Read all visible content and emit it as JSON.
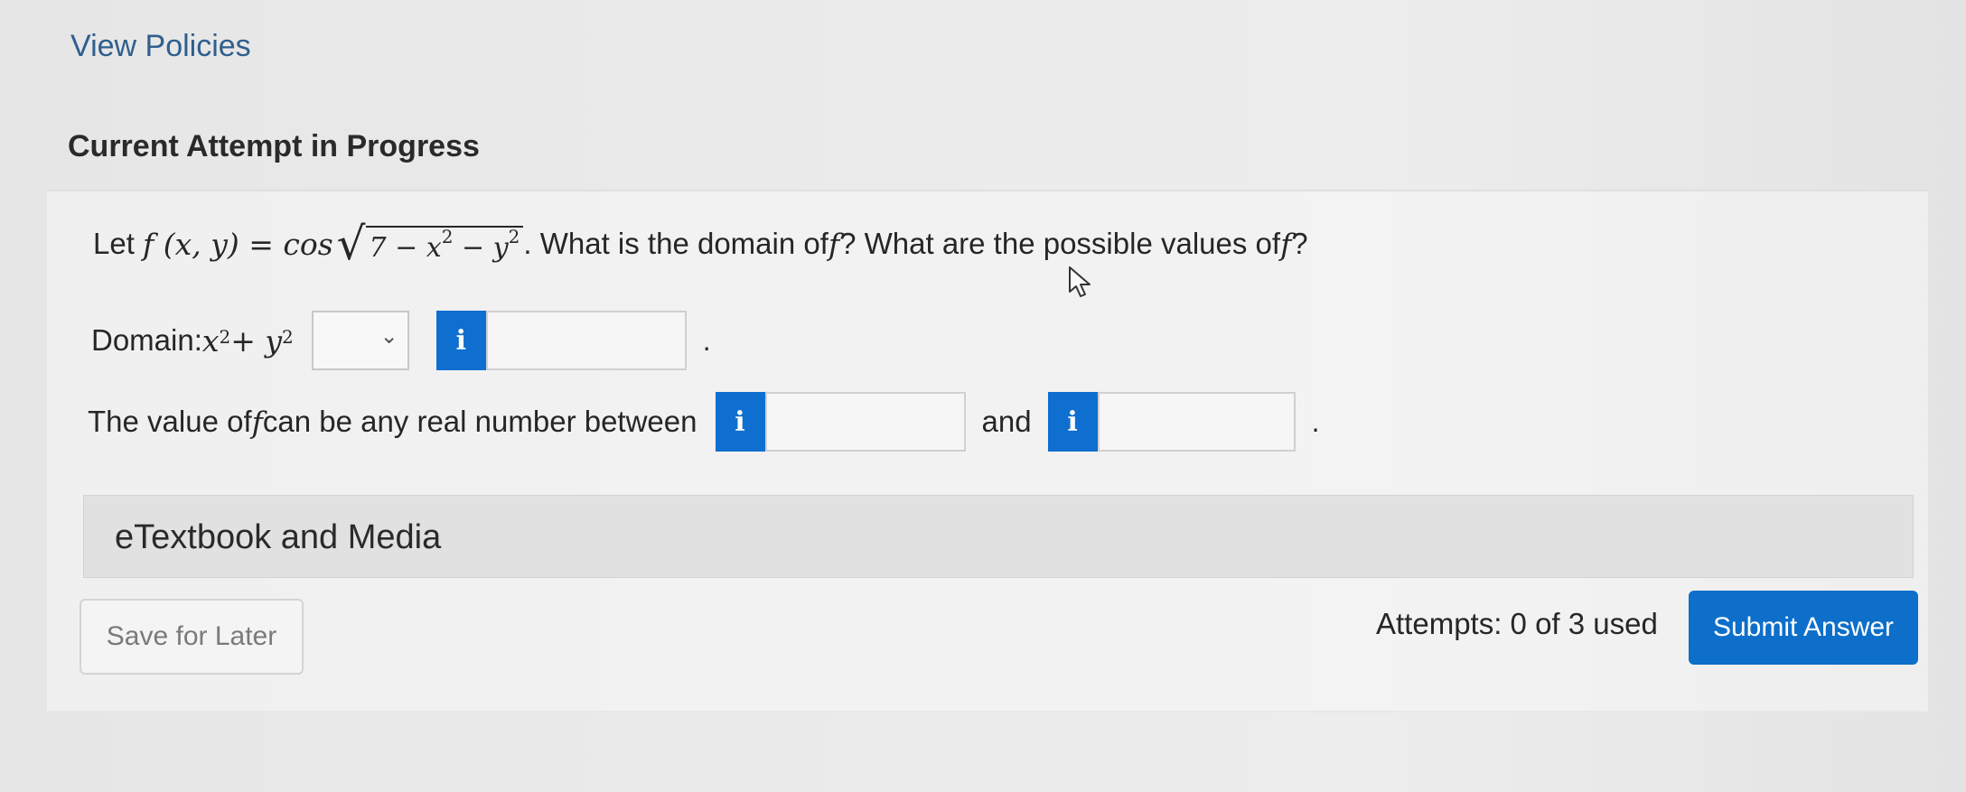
{
  "nav": {
    "view_policies": "View Policies"
  },
  "heading": "Current Attempt in Progress",
  "question": {
    "prefix": "Let ",
    "fn": "f (x, y) = cos",
    "radicand_a": "7 − x",
    "sup1": "2",
    "radicand_b": " − y",
    "sup2": "2",
    "suffix_a": ". What is the domain of ",
    "f1": "f",
    "suffix_b": "? What are the possible values of ",
    "f2": "f",
    "suffix_c": "?"
  },
  "domain": {
    "label": "Domain: ",
    "expr_a": "x",
    "sup1": "2",
    "expr_b": " + y",
    "sup2": "2",
    "info_icon": "i",
    "period": "."
  },
  "range": {
    "label_a": "The value of ",
    "f": "f",
    "label_b": " can be any real number between",
    "and": "and",
    "info_icon": "i",
    "period": "."
  },
  "etextbook": "eTextbook and Media",
  "footer": {
    "save_label": "Save for Later",
    "attempts": "Attempts: 0 of 3 used",
    "submit_label": "Submit Answer"
  },
  "colors": {
    "accent": "#0f6fd0",
    "link": "#2f5f8e"
  },
  "icons": [
    "info-icon",
    "chevron-down-icon",
    "mouse-pointer-icon"
  ]
}
